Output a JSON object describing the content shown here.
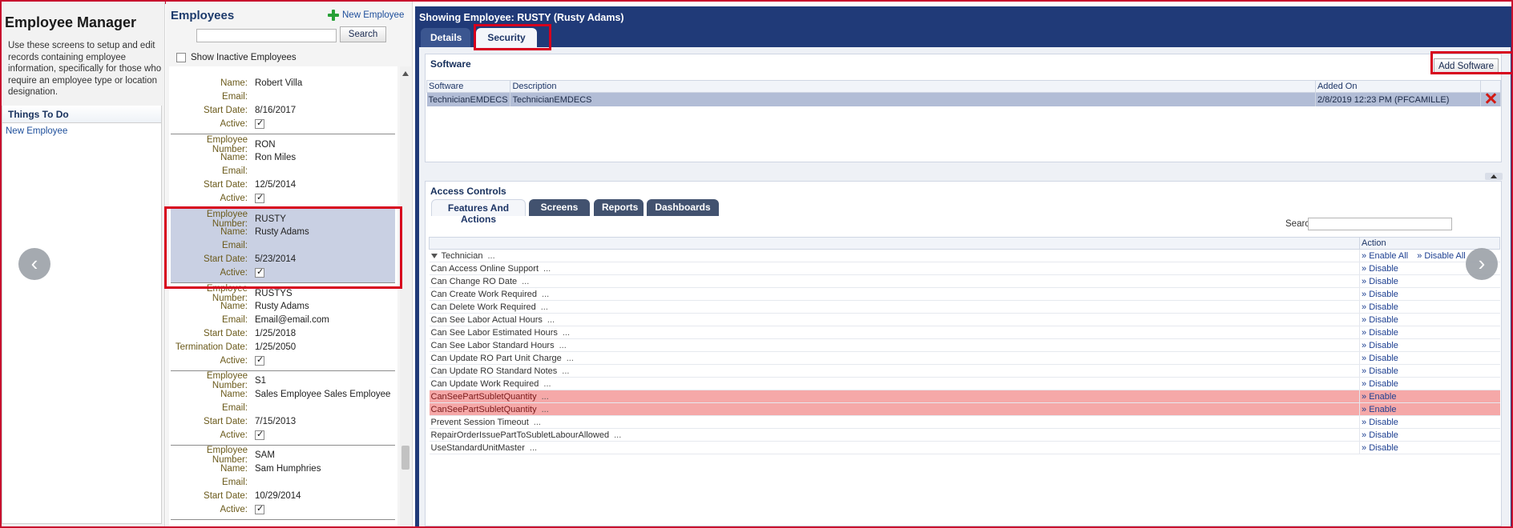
{
  "sidebar": {
    "title": "Employee Manager",
    "description": "Use these screens to setup and edit records containing employee information, specifically for those who require an employee type or location designation.",
    "things_to_do_title": "Things To Do",
    "things_to_do_link": "New Employee"
  },
  "employees": {
    "title": "Employees",
    "new_label": "New Employee",
    "search_button": "Search",
    "search_placeholder": "",
    "show_inactive_label": "Show Inactive Employees",
    "labels": {
      "number": "Employee Number:",
      "name": "Name:",
      "email": "Email:",
      "start": "Start Date:",
      "termination": "Termination Date:",
      "active": "Active:"
    },
    "cards": [
      {
        "name": "Robert Villa",
        "email": "",
        "start": "8/16/2017",
        "active": true
      },
      {
        "number": "RON",
        "name": "Ron Miles",
        "email": "",
        "start": "12/5/2014",
        "active": true
      },
      {
        "number": "RUSTY",
        "name": "Rusty Adams",
        "email": "",
        "start": "5/23/2014",
        "active": true,
        "selected": true
      },
      {
        "number": "RUSTYS",
        "name": "Rusty Adams",
        "email": "Email@email.com",
        "start": "1/25/2018",
        "termination": "1/25/2050",
        "active": true
      },
      {
        "number": "S1",
        "name": "Sales Employee Sales Employee",
        "email": "",
        "start": "7/15/2013",
        "active": true
      },
      {
        "number": "SAM",
        "name": "Sam Humphries",
        "email": "",
        "start": "10/29/2014",
        "active": true
      }
    ]
  },
  "detail": {
    "showing": "Showing Employee: RUSTY (Rusty Adams)",
    "tabs": [
      "Details",
      "Security"
    ],
    "active_tab": "Security",
    "software": {
      "title": "Software",
      "add_button": "Add Software",
      "columns": [
        "Software",
        "Description",
        "Added On"
      ],
      "rows": [
        {
          "software": "TechnicianEMDECS",
          "description": "TechnicianEMDECS",
          "added_on": "2/8/2019 12:23 PM (PFCAMILLE)"
        }
      ]
    },
    "access": {
      "title": "Access Controls",
      "tabs": [
        "Features And Actions",
        "Screens",
        "Reports",
        "Dashboards"
      ],
      "search_label": "Search:",
      "action_header": "Action",
      "group": {
        "name": "Technician",
        "dots": "...",
        "enable_all": "» Enable All",
        "disable_all": "» Disable All"
      },
      "permissions": [
        {
          "name": "Can Access Online Support",
          "action": "» Disable",
          "highlight": false
        },
        {
          "name": "Can Change RO Date",
          "action": "» Disable",
          "highlight": false
        },
        {
          "name": "Can Create Work Required",
          "action": "» Disable",
          "highlight": false
        },
        {
          "name": "Can Delete Work Required",
          "action": "» Disable",
          "highlight": false
        },
        {
          "name": "Can See Labor Actual Hours",
          "action": "» Disable",
          "highlight": false
        },
        {
          "name": "Can See Labor Estimated Hours",
          "action": "» Disable",
          "highlight": false
        },
        {
          "name": "Can See Labor Standard Hours",
          "action": "» Disable",
          "highlight": false
        },
        {
          "name": "Can Update RO Part Unit Charge",
          "action": "» Disable",
          "highlight": false
        },
        {
          "name": "Can Update RO Standard Notes",
          "action": "» Disable",
          "highlight": false
        },
        {
          "name": "Can Update Work Required",
          "action": "» Disable",
          "highlight": false
        },
        {
          "name": "CanSeePartSubletQuantity",
          "action": "» Enable",
          "highlight": true
        },
        {
          "name": "CanSeePartSubletQuantity",
          "action": "» Enable",
          "highlight": true
        },
        {
          "name": "Prevent Session Timeout",
          "action": "» Disable",
          "highlight": false
        },
        {
          "name": "RepairOrderIssuePartToSubletLabourAllowed",
          "action": "» Disable",
          "highlight": false
        },
        {
          "name": "UseStandardUnitMaster",
          "action": "» Disable",
          "highlight": false
        }
      ]
    }
  },
  "nav": {
    "prev_glyph": "‹",
    "next_glyph": "›"
  },
  "colors": {
    "header_blue": "#203a78",
    "highlight_red": "#f5a8a8",
    "annotation_red": "#d7001d",
    "selected_row": "#c9d0e3"
  }
}
